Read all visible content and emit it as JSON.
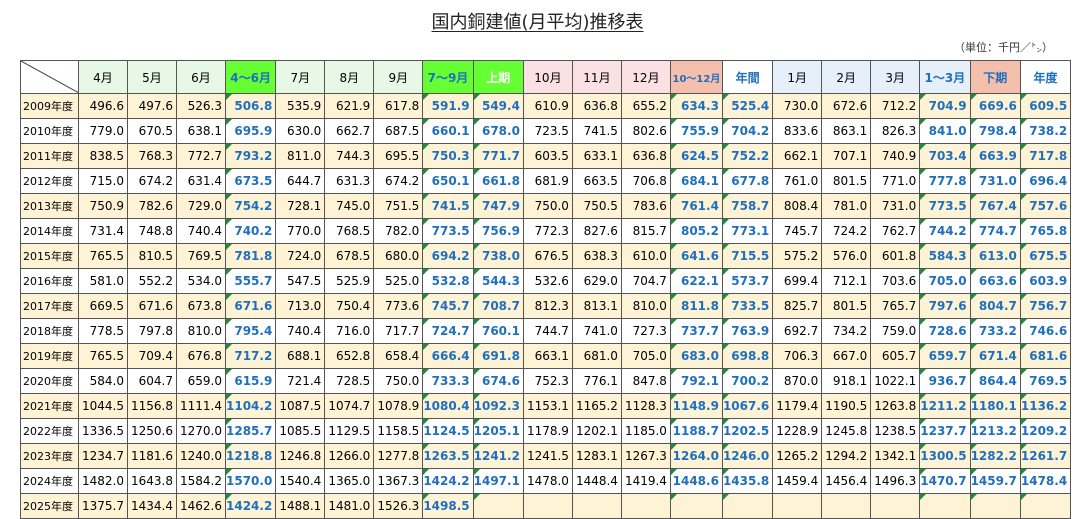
{
  "title": "国内銅建値(月平均)推移表",
  "unit": "（単位：千円／㌧）",
  "headers": [
    "4月",
    "5月",
    "6月",
    "4～6月",
    "7月",
    "8月",
    "9月",
    "7～9月",
    "上期",
    "10月",
    "11月",
    "12月",
    "10～12月",
    "年間",
    "1月",
    "2月",
    "3月",
    "1～3月",
    "下期",
    "年度"
  ],
  "rows": [
    {
      "label": "2009年度",
      "values": [
        "496.6",
        "497.6",
        "526.3",
        "506.8",
        "535.9",
        "621.9",
        "617.8",
        "591.9",
        "549.4",
        "610.9",
        "636.8",
        "655.2",
        "634.3",
        "525.4",
        "730.0",
        "672.6",
        "712.2",
        "704.9",
        "669.6",
        "609.5"
      ]
    },
    {
      "label": "2010年度",
      "values": [
        "779.0",
        "670.5",
        "638.1",
        "695.9",
        "630.0",
        "662.7",
        "687.5",
        "660.1",
        "678.0",
        "723.5",
        "741.5",
        "802.6",
        "755.9",
        "704.2",
        "833.6",
        "863.1",
        "826.3",
        "841.0",
        "798.4",
        "738.2"
      ]
    },
    {
      "label": "2011年度",
      "values": [
        "838.5",
        "768.3",
        "772.7",
        "793.2",
        "811.0",
        "744.3",
        "695.5",
        "750.3",
        "771.7",
        "603.5",
        "633.1",
        "636.8",
        "624.5",
        "752.2",
        "662.1",
        "707.1",
        "740.9",
        "703.4",
        "663.9",
        "717.8"
      ]
    },
    {
      "label": "2012年度",
      "values": [
        "715.0",
        "674.2",
        "631.4",
        "673.5",
        "644.7",
        "631.3",
        "674.2",
        "650.1",
        "661.8",
        "681.9",
        "663.5",
        "706.8",
        "684.1",
        "677.8",
        "761.0",
        "801.5",
        "771.0",
        "777.8",
        "731.0",
        "696.4"
      ]
    },
    {
      "label": "2013年度",
      "values": [
        "750.9",
        "782.6",
        "729.0",
        "754.2",
        "728.1",
        "745.0",
        "751.5",
        "741.5",
        "747.9",
        "750.0",
        "750.5",
        "783.6",
        "761.4",
        "758.7",
        "808.4",
        "781.0",
        "731.0",
        "773.5",
        "767.4",
        "757.6"
      ]
    },
    {
      "label": "2014年度",
      "values": [
        "731.4",
        "748.8",
        "740.4",
        "740.2",
        "770.0",
        "768.5",
        "782.0",
        "773.5",
        "756.9",
        "772.3",
        "827.6",
        "815.7",
        "805.2",
        "773.1",
        "745.7",
        "724.2",
        "762.7",
        "744.2",
        "774.7",
        "765.8"
      ]
    },
    {
      "label": "2015年度",
      "values": [
        "765.5",
        "810.5",
        "769.5",
        "781.8",
        "724.0",
        "678.5",
        "680.0",
        "694.2",
        "738.0",
        "676.5",
        "638.3",
        "610.0",
        "641.6",
        "715.5",
        "575.2",
        "576.0",
        "601.8",
        "584.3",
        "613.0",
        "675.5"
      ]
    },
    {
      "label": "2016年度",
      "values": [
        "581.0",
        "552.2",
        "534.0",
        "555.7",
        "547.5",
        "525.9",
        "525.0",
        "532.8",
        "544.3",
        "532.6",
        "629.0",
        "704.7",
        "622.1",
        "573.7",
        "699.4",
        "712.1",
        "703.6",
        "705.0",
        "663.6",
        "603.9"
      ]
    },
    {
      "label": "2017年度",
      "values": [
        "669.5",
        "671.6",
        "673.8",
        "671.6",
        "713.0",
        "750.4",
        "773.6",
        "745.7",
        "708.7",
        "812.3",
        "813.1",
        "810.0",
        "811.8",
        "733.5",
        "825.7",
        "801.5",
        "765.7",
        "797.6",
        "804.7",
        "756.7"
      ]
    },
    {
      "label": "2018年度",
      "values": [
        "778.5",
        "797.8",
        "810.0",
        "795.4",
        "740.4",
        "716.0",
        "717.7",
        "724.7",
        "760.1",
        "744.7",
        "741.0",
        "727.3",
        "737.7",
        "763.9",
        "692.7",
        "734.2",
        "759.0",
        "728.6",
        "733.2",
        "746.6"
      ]
    },
    {
      "label": "2019年度",
      "values": [
        "765.5",
        "709.4",
        "676.8",
        "717.2",
        "688.1",
        "652.8",
        "658.4",
        "666.4",
        "691.8",
        "663.1",
        "681.0",
        "705.0",
        "683.0",
        "698.8",
        "706.3",
        "667.0",
        "605.7",
        "659.7",
        "671.4",
        "681.6"
      ]
    },
    {
      "label": "2020年度",
      "values": [
        "584.0",
        "604.7",
        "659.0",
        "615.9",
        "721.4",
        "728.5",
        "750.0",
        "733.3",
        "674.6",
        "752.3",
        "776.1",
        "847.8",
        "792.1",
        "700.2",
        "870.0",
        "918.1",
        "1022.1",
        "936.7",
        "864.4",
        "769.5"
      ]
    },
    {
      "label": "2021年度",
      "values": [
        "1044.5",
        "1156.8",
        "1111.4",
        "1104.2",
        "1087.5",
        "1074.7",
        "1078.9",
        "1080.4",
        "1092.3",
        "1153.1",
        "1165.2",
        "1128.3",
        "1148.9",
        "1067.6",
        "1179.4",
        "1190.5",
        "1263.8",
        "1211.2",
        "1180.1",
        "1136.2"
      ]
    },
    {
      "label": "2022年度",
      "values": [
        "1336.5",
        "1250.6",
        "1270.0",
        "1285.7",
        "1085.5",
        "1129.5",
        "1158.5",
        "1124.5",
        "1205.1",
        "1178.9",
        "1202.1",
        "1185.0",
        "1188.7",
        "1202.5",
        "1228.9",
        "1245.8",
        "1238.5",
        "1237.7",
        "1213.2",
        "1209.2"
      ]
    },
    {
      "label": "2023年度",
      "values": [
        "1234.7",
        "1181.6",
        "1240.0",
        "1218.8",
        "1246.8",
        "1266.0",
        "1277.8",
        "1263.5",
        "1241.2",
        "1241.5",
        "1283.1",
        "1267.3",
        "1264.0",
        "1246.0",
        "1265.2",
        "1294.2",
        "1342.1",
        "1300.5",
        "1282.2",
        "1261.7"
      ]
    },
    {
      "label": "2024年度",
      "values": [
        "1482.0",
        "1643.8",
        "1584.2",
        "1570.0",
        "1540.4",
        "1365.0",
        "1367.3",
        "1424.2",
        "1497.1",
        "1478.0",
        "1448.4",
        "1419.4",
        "1448.6",
        "1435.8",
        "1459.4",
        "1456.4",
        "1496.3",
        "1470.7",
        "1459.7",
        "1478.4"
      ]
    },
    {
      "label": "2025年度",
      "values": [
        "1375.7",
        "1434.4",
        "1462.6",
        "1424.2",
        "1488.1",
        "1481.0",
        "1526.3",
        "1498.5",
        "",
        "",
        "",
        "",
        "",
        "",
        "",
        "",
        "",
        "",
        "",
        ""
      ]
    }
  ]
}
